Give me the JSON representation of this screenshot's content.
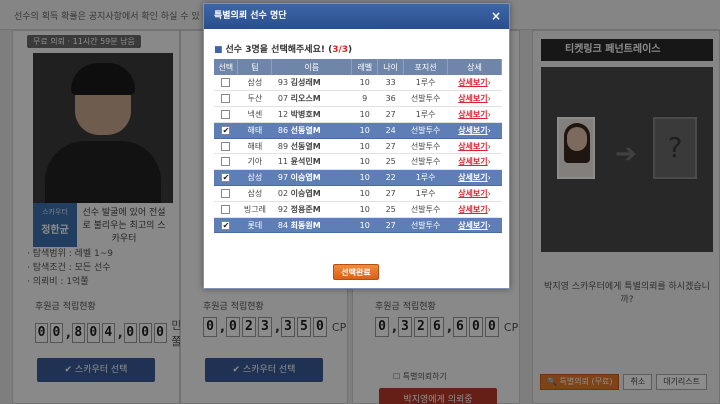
{
  "background": {
    "notice": "선수의 획득 확률은 공지사항에서 확인 하실 수 있",
    "panels": [
      {
        "timer": "11시간 59분 남음",
        "timer_prefix": "무료 의뢰",
        "badge_small": "스카우터",
        "badge_name": "정한균",
        "quote": "선수 발굴에 있어 전설로 불리우는 최고의 스카우터",
        "info": [
          "탐색범위 : 레벨 1~9",
          "탐색조건 : 모든 선수",
          "의뢰비 : 1억쭐"
        ],
        "acc_label": "후원금 적립현황",
        "digits": [
          "0",
          "0",
          "8",
          "0",
          "4",
          "0",
          "0",
          "0"
        ],
        "unit": "만쭐",
        "button": "스카우터 선택"
      },
      {
        "acc_label": "후원금 적립현황",
        "digits": [
          "0",
          "0",
          "2",
          "3",
          "3",
          "5",
          "0"
        ],
        "unit": "CP",
        "button": "스카우터 선택"
      },
      {
        "acc_label": "후원금 적립현황",
        "digits": [
          "0",
          "3",
          "2",
          "6",
          "6",
          "0",
          "0"
        ],
        "unit": "CP",
        "check_label": "특별의뢰하기",
        "button": "박지영에게 의뢰중"
      }
    ],
    "right": {
      "title": "티켓링크 페넌트레이스",
      "message": "박지영 스카우터에게 특별의뢰를 하시겠습니까?"
    },
    "bottom_buttons": [
      "특별의뢰 (무료)",
      "취소",
      "대기리스트"
    ]
  },
  "modal": {
    "title": "특별의뢰 선수 명단",
    "close": "×",
    "subtitle": "선수 3명을 선택해주세요!",
    "count": "3/3",
    "headers": [
      "선택",
      "팀",
      "이름",
      "레벨",
      "나이",
      "포지션",
      "상세"
    ],
    "rows": [
      {
        "team": "삼성",
        "num": "93",
        "name": "김성래M",
        "level": "10",
        "age": "33",
        "pos": "1루수",
        "selected": false
      },
      {
        "team": "두산",
        "num": "07",
        "name": "리오스M",
        "level": "9",
        "age": "36",
        "pos": "선발투수",
        "selected": false
      },
      {
        "team": "넥센",
        "num": "12",
        "name": "박병호M",
        "level": "10",
        "age": "27",
        "pos": "1루수",
        "selected": false
      },
      {
        "team": "해태",
        "num": "86",
        "name": "선동열M",
        "level": "10",
        "age": "24",
        "pos": "선발투수",
        "selected": true
      },
      {
        "team": "해태",
        "num": "89",
        "name": "선동열M",
        "level": "10",
        "age": "27",
        "pos": "선발투수",
        "selected": false
      },
      {
        "team": "기아",
        "num": "11",
        "name": "윤석민M",
        "level": "10",
        "age": "25",
        "pos": "선발투수",
        "selected": false
      },
      {
        "team": "삼성",
        "num": "97",
        "name": "이승엽M",
        "level": "10",
        "age": "22",
        "pos": "1루수",
        "selected": true
      },
      {
        "team": "삼성",
        "num": "02",
        "name": "이승엽M",
        "level": "10",
        "age": "27",
        "pos": "1루수",
        "selected": false
      },
      {
        "team": "빙그레",
        "num": "92",
        "name": "정용준M",
        "level": "10",
        "age": "25",
        "pos": "선발투수",
        "selected": false
      },
      {
        "team": "롯데",
        "num": "84",
        "name": "최동원M",
        "level": "10",
        "age": "27",
        "pos": "선발투수",
        "selected": true
      }
    ],
    "detail_label": "상세보기",
    "confirm": "선택완료"
  },
  "colors": {
    "header_blue": "#2a4e8c",
    "selected_row": "#5e7fb5",
    "detail_red": "#d22233",
    "confirm_orange": "#e87a2f"
  }
}
